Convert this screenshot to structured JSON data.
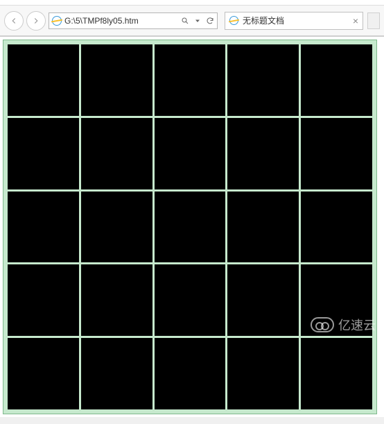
{
  "address_bar": {
    "url": "G:\\5\\TMPf8ly05.htm",
    "search_separator": "▾"
  },
  "tab": {
    "title": "无标题文档"
  },
  "grid": {
    "rows": 5,
    "cols": 5,
    "cell_bg": "#000000",
    "page_bg": "#c6e9cd",
    "border_color": "#7fb98c"
  },
  "watermark": {
    "text": "亿速云"
  }
}
